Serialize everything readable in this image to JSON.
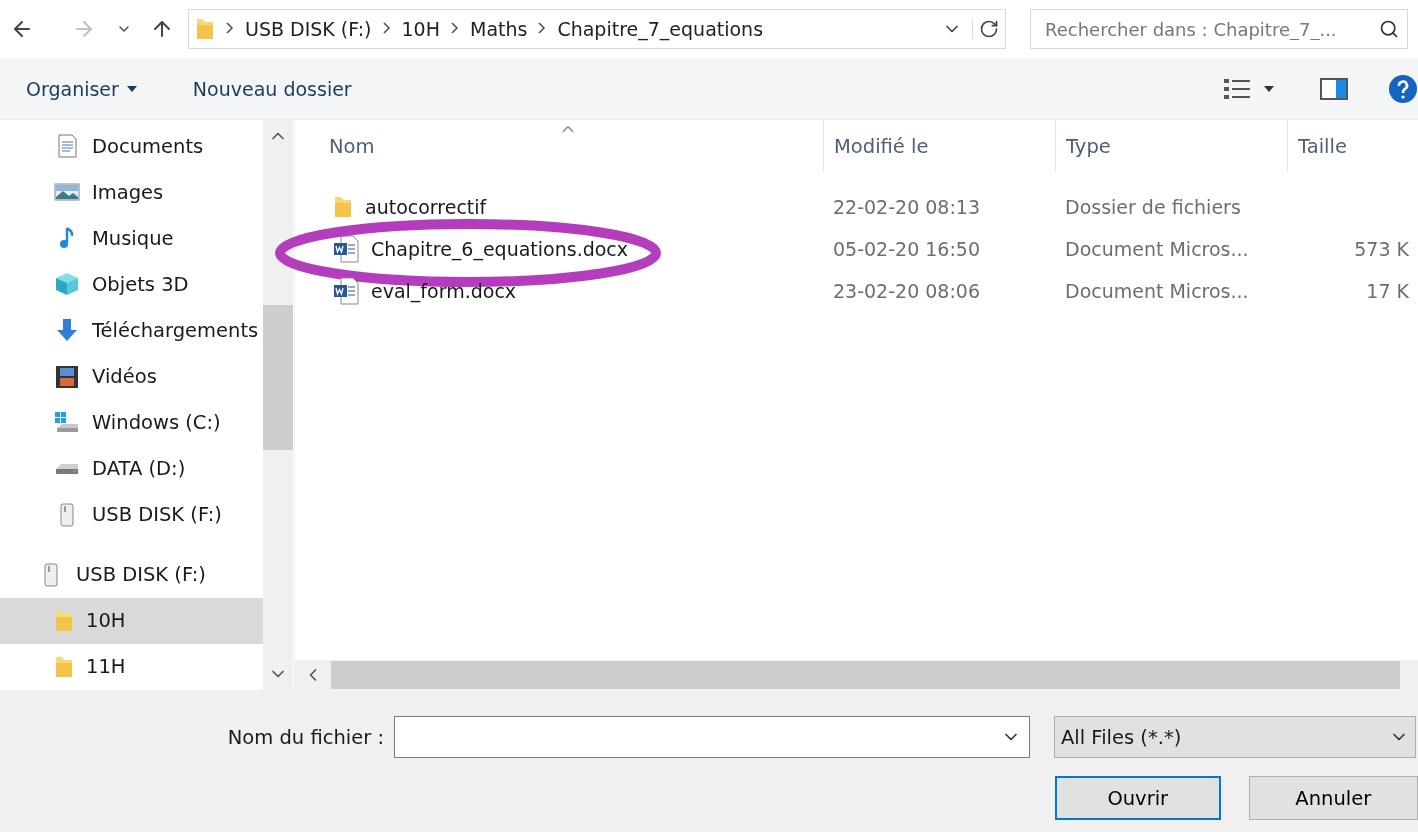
{
  "navigation": {
    "breadcrumb": [
      "USB DISK (F:)",
      "10H",
      "Maths",
      "Chapitre_7_equations"
    ],
    "search": {
      "placeholder": "Rechercher dans : Chapitre_7_..."
    }
  },
  "toolbar": {
    "organize": "Organiser",
    "new_folder": "Nouveau dossier"
  },
  "sidebar": {
    "items": [
      {
        "label": "Documents",
        "kind": "documents",
        "selected": false
      },
      {
        "label": "Images",
        "kind": "images",
        "selected": false
      },
      {
        "label": "Musique",
        "kind": "music",
        "selected": false
      },
      {
        "label": "Objets 3D",
        "kind": "cube",
        "selected": false
      },
      {
        "label": "Téléchargements",
        "kind": "download",
        "selected": false
      },
      {
        "label": "Vidéos",
        "kind": "video",
        "selected": false
      },
      {
        "label": "Windows (C:)",
        "kind": "windows-drive",
        "selected": false
      },
      {
        "label": "DATA (D:)",
        "kind": "drive",
        "selected": false
      },
      {
        "label": "USB DISK (F:)",
        "kind": "usb",
        "selected": false
      }
    ],
    "tree": {
      "label": "USB DISK (F:)",
      "kind": "usb",
      "children": [
        {
          "label": "10H",
          "kind": "folder",
          "selected": true
        },
        {
          "label": "11H",
          "kind": "folder",
          "selected": false
        }
      ]
    }
  },
  "table": {
    "columns": [
      "Nom",
      "Modifié le",
      "Type",
      "Taille"
    ],
    "rows": [
      {
        "name": "autocorrectif",
        "kind": "folder",
        "modified": "22-02-20 08:13",
        "type": "Dossier de fichiers",
        "size": ""
      },
      {
        "name": "Chapitre_6_equations.docx",
        "kind": "word",
        "modified": "05-02-20 16:50",
        "type": "Document Micros...",
        "size": "573 K",
        "circled": true
      },
      {
        "name": "eval_form.docx",
        "kind": "word",
        "modified": "23-02-20 08:06",
        "type": "Document Micros...",
        "size": "17 K",
        "circled": false
      }
    ]
  },
  "footer": {
    "filename_label": "Nom du fichier :",
    "filter": "All Files (*.*)",
    "open": "Ouvrir",
    "cancel": "Annuler"
  }
}
